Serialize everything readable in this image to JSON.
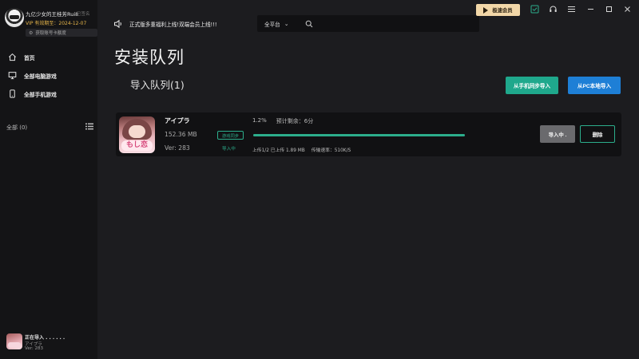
{
  "user": {
    "name": "九亿少女的王桂芳Rui8",
    "status": "已签名",
    "vip_expiry": "VIP 有效期至：2024-12-07",
    "get_vip_label": "获取账号卡额度"
  },
  "sidebar": {
    "items": [
      {
        "label": "首页",
        "icon": "home-icon"
      },
      {
        "label": "全部电脑游戏",
        "icon": "monitor-icon"
      },
      {
        "label": "全部手机游戏",
        "icon": "phone-icon"
      }
    ],
    "all_label": "全部 (0)"
  },
  "bottom_status": {
    "title": "正在导入 . . . . . .",
    "game": "アイプラ",
    "version": "Ver: 283"
  },
  "notice": {
    "text": "正式版多重福利上线!双端会员上线!!!"
  },
  "search": {
    "platform": "全平台",
    "placeholder": ""
  },
  "topbar": {
    "speed_vip": "极速会员",
    "icons": [
      "checklist-icon",
      "headset-icon",
      "menu-icon",
      "minimize-icon",
      "maximize-icon",
      "close-icon"
    ]
  },
  "main": {
    "title": "安装队列",
    "queue_title": "导入队列(1)",
    "sync_button": "从手机同步导入",
    "pc_button": "从PC本地导入"
  },
  "queue_item": {
    "name": "アイプラ",
    "size": "152.36 MB",
    "version": "Ver: 283",
    "badge": "游戏同步",
    "state": "导入中",
    "progress_percent_label": "1.2%",
    "progress": 0.012,
    "eta": "预计剩余：6分",
    "upload": "上传1/2 已上传 1.89 MB",
    "speed": "传输速率：510K/S",
    "thumb_text": "もし恋",
    "importing_button": "导入中 .",
    "delete_button": "删除"
  },
  "colors": {
    "accent_green": "#2cae8c",
    "accent_blue": "#1e7fd6",
    "vip_gold": "#f2d7a8"
  }
}
